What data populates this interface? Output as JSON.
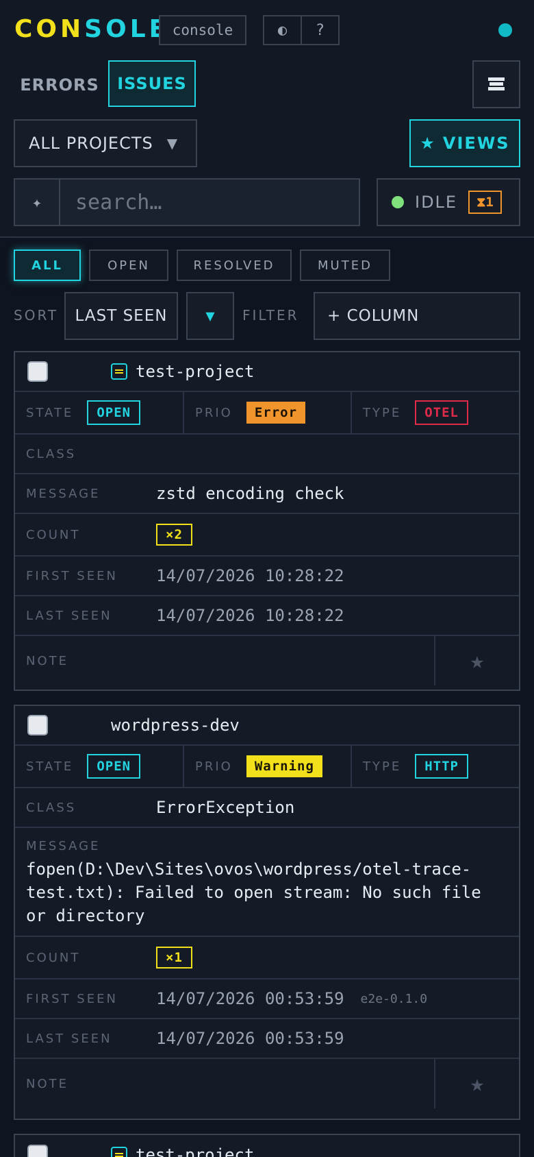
{
  "header": {
    "logo_part1": "CON",
    "logo_part2": "SOLE",
    "console_label": "console",
    "theme_icon": "◐",
    "help_icon": "?"
  },
  "tabs": {
    "errors": "ERRORS",
    "issues": "ISSUES"
  },
  "project_select": {
    "value": "ALL PROJECTS",
    "caret": "▼"
  },
  "views": {
    "star": "★",
    "label": "VIEWS"
  },
  "search": {
    "icon": "✦",
    "placeholder": "search…"
  },
  "status": {
    "label": "IDLE",
    "queue": "⧗1"
  },
  "filters": {
    "all": "ALL",
    "open": "OPEN",
    "resolved": "RESOLVED",
    "muted": "MUTED"
  },
  "sort": {
    "label": "SORT",
    "value": "LAST SEEN",
    "direction": "▼"
  },
  "filter": {
    "label": "FILTER",
    "add_column": "+ COLUMN"
  },
  "labels": {
    "state": "STATE",
    "prio": "PRIO",
    "type": "TYPE",
    "class": "CLASS",
    "message": "MESSAGE",
    "count": "COUNT",
    "first_seen": "FIRST SEEN",
    "last_seen": "LAST SEEN",
    "note": "NOTE",
    "star": "★"
  },
  "issues": [
    {
      "project": "test-project",
      "state": "OPEN",
      "prio": "Error",
      "type": "OTEL",
      "class": "",
      "message": "zstd encoding check",
      "count": "×2",
      "first_seen": "14/07/2026 10:28:22",
      "last_seen": "14/07/2026 10:28:22"
    },
    {
      "project": "wordpress-dev",
      "state": "OPEN",
      "prio": "Warning",
      "type": "HTTP",
      "class": "ErrorException",
      "message": "fopen(D:\\Dev\\Sites\\ovos\\wordpress/otel-trace-test.txt): Failed to open stream: No such file or directory",
      "count": "×1",
      "first_seen": "14/07/2026 00:53:59",
      "version": "e2e-0.1.0",
      "last_seen": "14/07/2026 00:53:59"
    },
    {
      "project": "test-project"
    }
  ],
  "colors": {
    "accent_cyan": "#22d3e0",
    "accent_yellow": "#f2e01a",
    "prio_error": "#f0952b",
    "type_otel": "#e02a4a",
    "background": "#0f1520"
  }
}
